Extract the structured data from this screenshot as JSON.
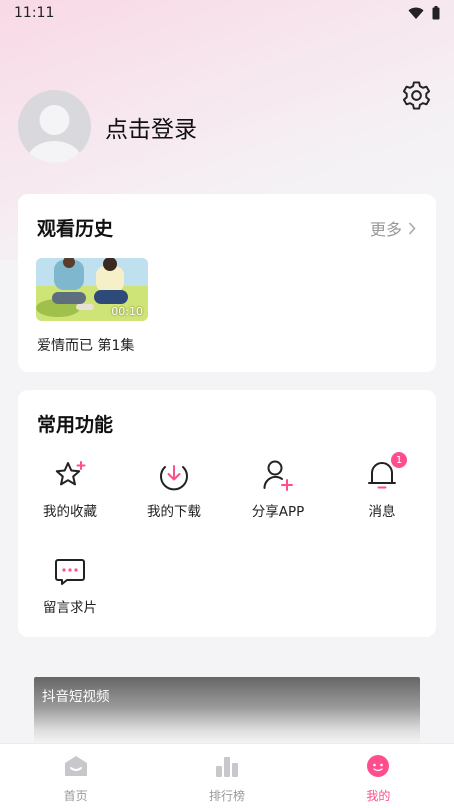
{
  "status_bar": {
    "time": "11:11"
  },
  "profile": {
    "login_label": "点击登录"
  },
  "history": {
    "title": "观看历史",
    "more_label": "更多",
    "items": [
      {
        "title": "爱情而已 第1集",
        "duration": "00:10"
      }
    ]
  },
  "functions": {
    "title": "常用功能",
    "items": [
      {
        "label": "我的收藏",
        "icon": "star-icon"
      },
      {
        "label": "我的下载",
        "icon": "download-icon"
      },
      {
        "label": "分享APP",
        "icon": "share-user-icon"
      },
      {
        "label": "消息",
        "icon": "bell-icon",
        "badge": "1"
      },
      {
        "label": "留言求片",
        "icon": "message-icon"
      }
    ]
  },
  "banner": {
    "label": "抖音短视频"
  },
  "tabbar": {
    "items": [
      {
        "label": "首页",
        "icon": "home-icon"
      },
      {
        "label": "排行榜",
        "icon": "ranking-icon"
      },
      {
        "label": "我的",
        "icon": "profile-smile-icon",
        "active": true
      }
    ]
  },
  "colors": {
    "accent": "#ff4d8d",
    "badge": "#ff4d8d"
  }
}
